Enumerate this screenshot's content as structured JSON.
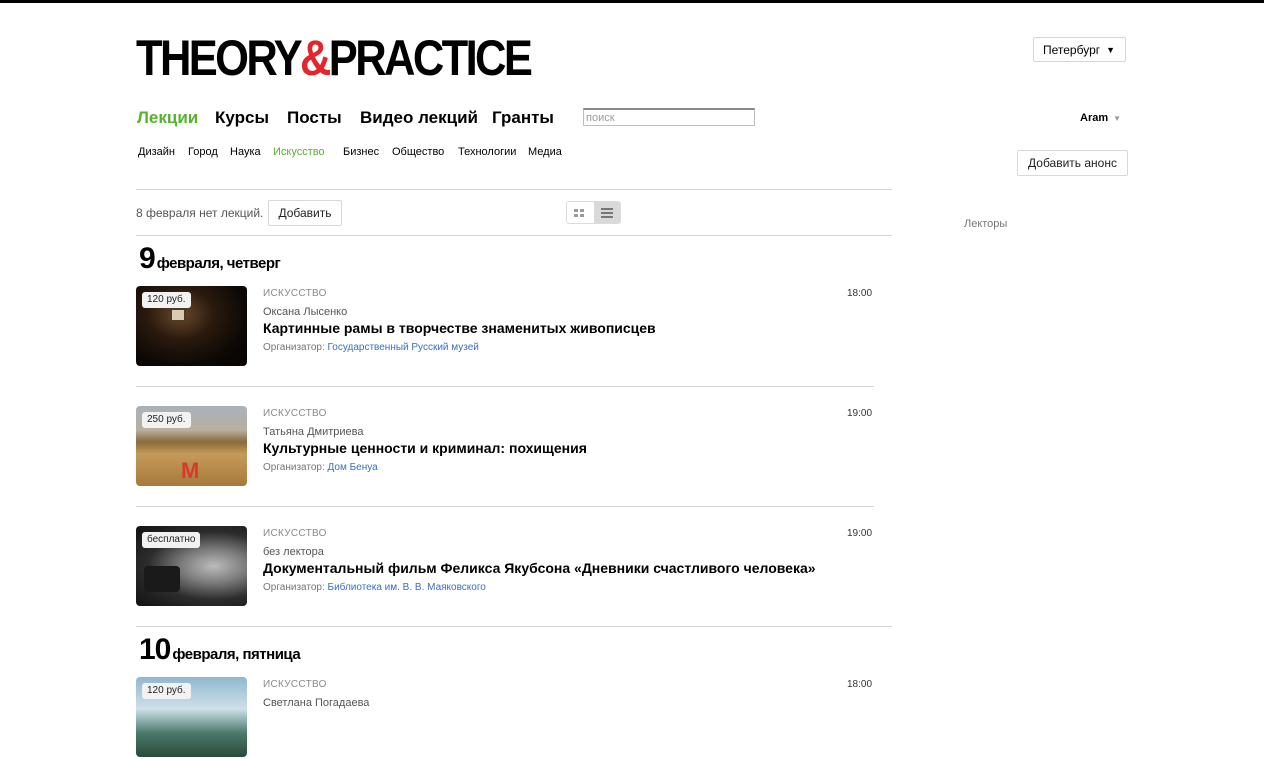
{
  "logo": {
    "part1": "THEORY",
    "amp": "&",
    "part2": "PRACTICE"
  },
  "city": {
    "value": "Петербург"
  },
  "main_nav": [
    "Лекции",
    "Курсы",
    "Посты",
    "Видео лекций",
    "Гранты"
  ],
  "search": {
    "placeholder": "поиск"
  },
  "user": {
    "name": "Aram"
  },
  "sub_nav": [
    "Дизайн",
    "Город",
    "Наука",
    "Искусство",
    "Бизнес",
    "Общество",
    "Технологии",
    "Медиа"
  ],
  "add_anons_label": "Добавить анонс",
  "no_lectures_text": "8 февраля нет лекций.",
  "add_label": "Добавить",
  "sidebar": {
    "lecturers_label": "Лекторы"
  },
  "days": [
    {
      "day": "9",
      "label": "февраля, четверг"
    },
    {
      "day": "10",
      "label": "февраля, пятница"
    }
  ],
  "organizer_label": "Организатор:",
  "events": [
    {
      "price": "120 руб.",
      "category": "искусство",
      "time": "18:00",
      "lecturer": "Оксана Лысенко",
      "title": "Картинные рамы в творчестве знаменитых живописцев",
      "organizer": "Государственный Русский музей"
    },
    {
      "price": "250 руб.",
      "category": "искусство",
      "time": "19:00",
      "lecturer": "Татьяна Дмитриева",
      "title": "Культурные ценности и криминал: похищения",
      "organizer": "Дом Бенуа"
    },
    {
      "price": "бесплатно",
      "category": "искусство",
      "time": "19:00",
      "lecturer": "без лектора",
      "title": "Документальный фильм Феликса Якубсона «Дневники счастливого человека»",
      "organizer": "Библиотека им. В. В. Маяковского"
    },
    {
      "price": "120 руб.",
      "category": "искусство",
      "time": "18:00",
      "lecturer": "Светлана Погадаева",
      "title": "",
      "organizer": ""
    }
  ],
  "colors": {
    "accent_green": "#55b32e",
    "logo_red": "#e3262b",
    "link_blue": "#3b6fc2"
  }
}
